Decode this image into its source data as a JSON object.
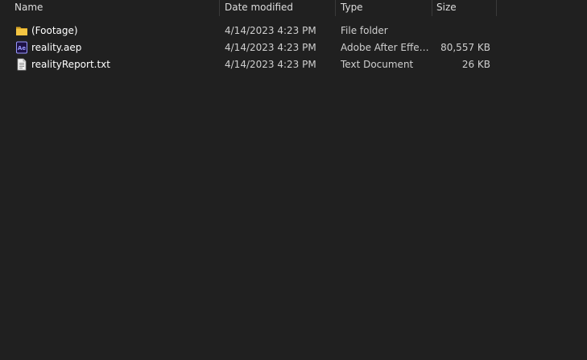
{
  "columns": {
    "name": "Name",
    "date_modified": "Date modified",
    "type": "Type",
    "size": "Size"
  },
  "files": [
    {
      "icon": "folder-icon",
      "name": "(Footage)",
      "date": "4/14/2023 4:23 PM",
      "type": "File folder",
      "size": ""
    },
    {
      "icon": "after-effects-icon",
      "name": "reality.aep",
      "date": "4/14/2023 4:23 PM",
      "type": "Adobe After Effect...",
      "size": "80,557 KB"
    },
    {
      "icon": "text-document-icon",
      "name": "realityReport.txt",
      "date": "4/14/2023 4:23 PM",
      "type": "Text Document",
      "size": "26 KB"
    }
  ],
  "colors": {
    "background": "#202020",
    "folder": "#f4c542",
    "after_effects": "#9999ff",
    "after_effects_bg": "#1e1246"
  },
  "icon_text": {
    "after_effects": "Ae"
  }
}
